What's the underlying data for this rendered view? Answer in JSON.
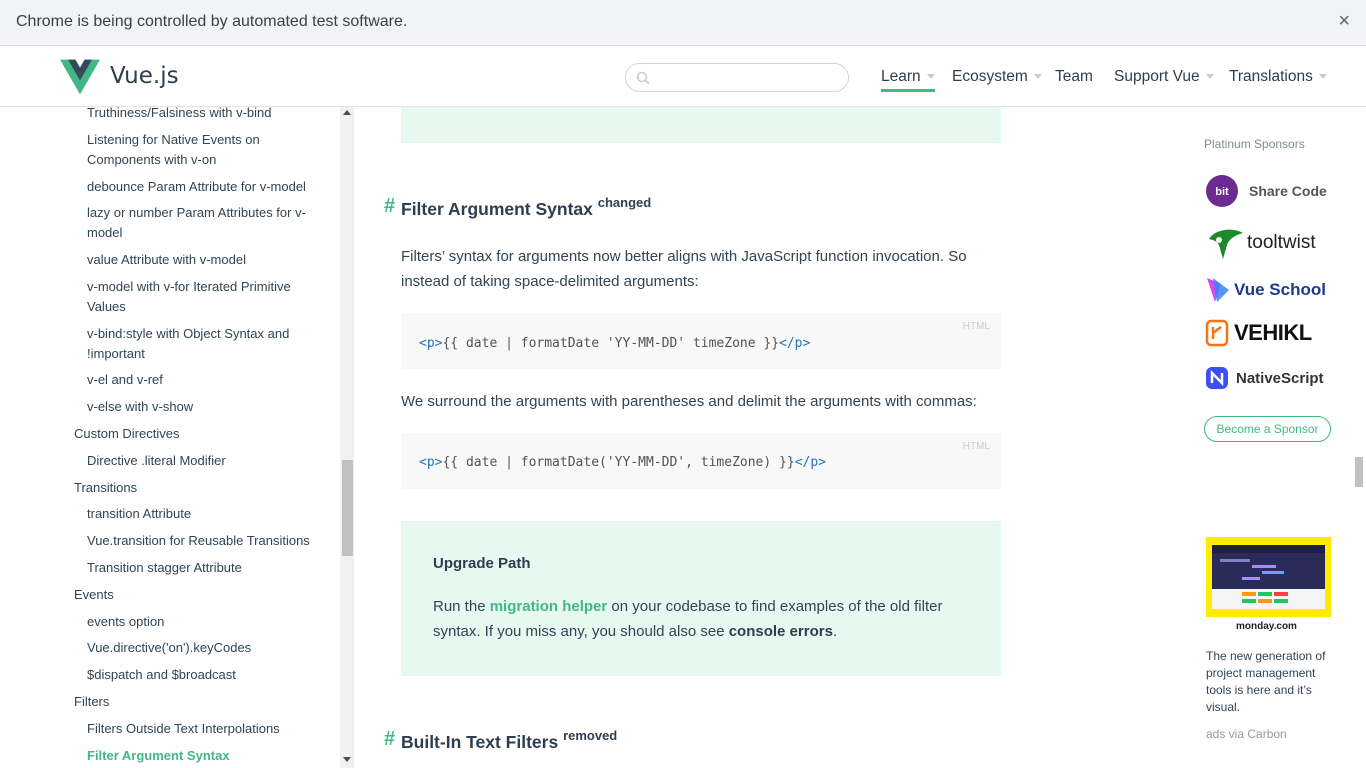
{
  "infobar": {
    "text": "Chrome is being controlled by automated test software.",
    "close": "×"
  },
  "header": {
    "brand": "Vue.js",
    "search_placeholder": "",
    "nav": [
      {
        "label": "Learn",
        "dropdown": true,
        "active": true
      },
      {
        "label": "Ecosystem",
        "dropdown": true
      },
      {
        "label": "Team",
        "dropdown": false
      },
      {
        "label": "Support Vue",
        "dropdown": true
      },
      {
        "label": "Translations",
        "dropdown": true
      }
    ]
  },
  "sidebar": {
    "items": [
      {
        "label": "Truthiness/Falsiness with v-bind",
        "level": 2
      },
      {
        "label": "Listening for Native Events on Components with v-on",
        "level": 2
      },
      {
        "label": "debounce Param Attribute for v-model",
        "level": 2
      },
      {
        "label": "lazy or number Param Attributes for v-model",
        "level": 2
      },
      {
        "label": "value Attribute with v-model",
        "level": 2
      },
      {
        "label": "v-model with v-for Iterated Primitive Values",
        "level": 2
      },
      {
        "label": "v-bind:style with Object Syntax and !important",
        "level": 2
      },
      {
        "label": "v-el and v-ref",
        "level": 2
      },
      {
        "label": "v-else with v-show",
        "level": 2
      },
      {
        "label": "Custom Directives",
        "level": 1
      },
      {
        "label": "Directive .literal Modifier",
        "level": 2
      },
      {
        "label": "Transitions",
        "level": 1
      },
      {
        "label": "transition Attribute",
        "level": 2
      },
      {
        "label": "Vue.transition for Reusable Transitions",
        "level": 2
      },
      {
        "label": "Transition stagger Attribute",
        "level": 2
      },
      {
        "label": "Events",
        "level": 1
      },
      {
        "label": "events option",
        "level": 2
      },
      {
        "label": "Vue.directive('on').keyCodes",
        "level": 2
      },
      {
        "label": "$dispatch and $broadcast",
        "level": 2
      },
      {
        "label": "Filters",
        "level": 1
      },
      {
        "label": "Filters Outside Text Interpolations",
        "level": 2
      },
      {
        "label": "Filter Argument Syntax",
        "level": 2,
        "active": true
      }
    ]
  },
  "main": {
    "section1": {
      "hash": "#",
      "title": "Filter Argument Syntax",
      "badge": "changed"
    },
    "para1": "Filters’ syntax for arguments now better aligns with JavaScript function invocation. So instead of taking space-delimited arguments:",
    "code1": {
      "lang": "HTML",
      "open": "<p>",
      "body": "{{ date | formatDate 'YY-MM-DD' timeZone }}",
      "close": "</p>"
    },
    "para2": "We surround the arguments with parentheses and delimit the arguments with commas:",
    "code2": {
      "lang": "HTML",
      "open": "<p>",
      "body": "{{ date | formatDate('YY-MM-DD', timeZone) }}",
      "close": "</p>"
    },
    "upgrade": {
      "title": "Upgrade Path",
      "text_before": "Run the ",
      "link": "migration helper",
      "text_middle": " on your codebase to find examples of the old filter syntax. If you miss any, you should also see ",
      "bold": "console errors",
      "text_after": "."
    },
    "section2": {
      "hash": "#",
      "title": "Built-In Text Filters",
      "badge": "removed"
    }
  },
  "sponsors": {
    "title": "Platinum Sponsors",
    "items": [
      {
        "name": "Share Code",
        "icon": "bit-icon",
        "color": "#6c2b91"
      },
      {
        "name": "tooltwist",
        "icon": "tooltwist-icon",
        "color": "#1a8a2a"
      },
      {
        "name": "Vue School",
        "icon": "vueschool-icon",
        "color": "#1e40af"
      },
      {
        "name": "VEHIKL",
        "icon": "vehikl-icon",
        "color": "#f97316"
      },
      {
        "name": "NativeScript",
        "icon": "nativescript-icon",
        "color": "#3d4ff2"
      }
    ],
    "become": "Become a Sponsor"
  },
  "ad": {
    "brand": "monday.com",
    "text": "The new generation of project management tools is here and it’s visual.",
    "via": "ads via Carbon"
  },
  "colors": {
    "accent": "#42b983",
    "text": "#304455",
    "tip_bg": "#e7f8f0"
  }
}
